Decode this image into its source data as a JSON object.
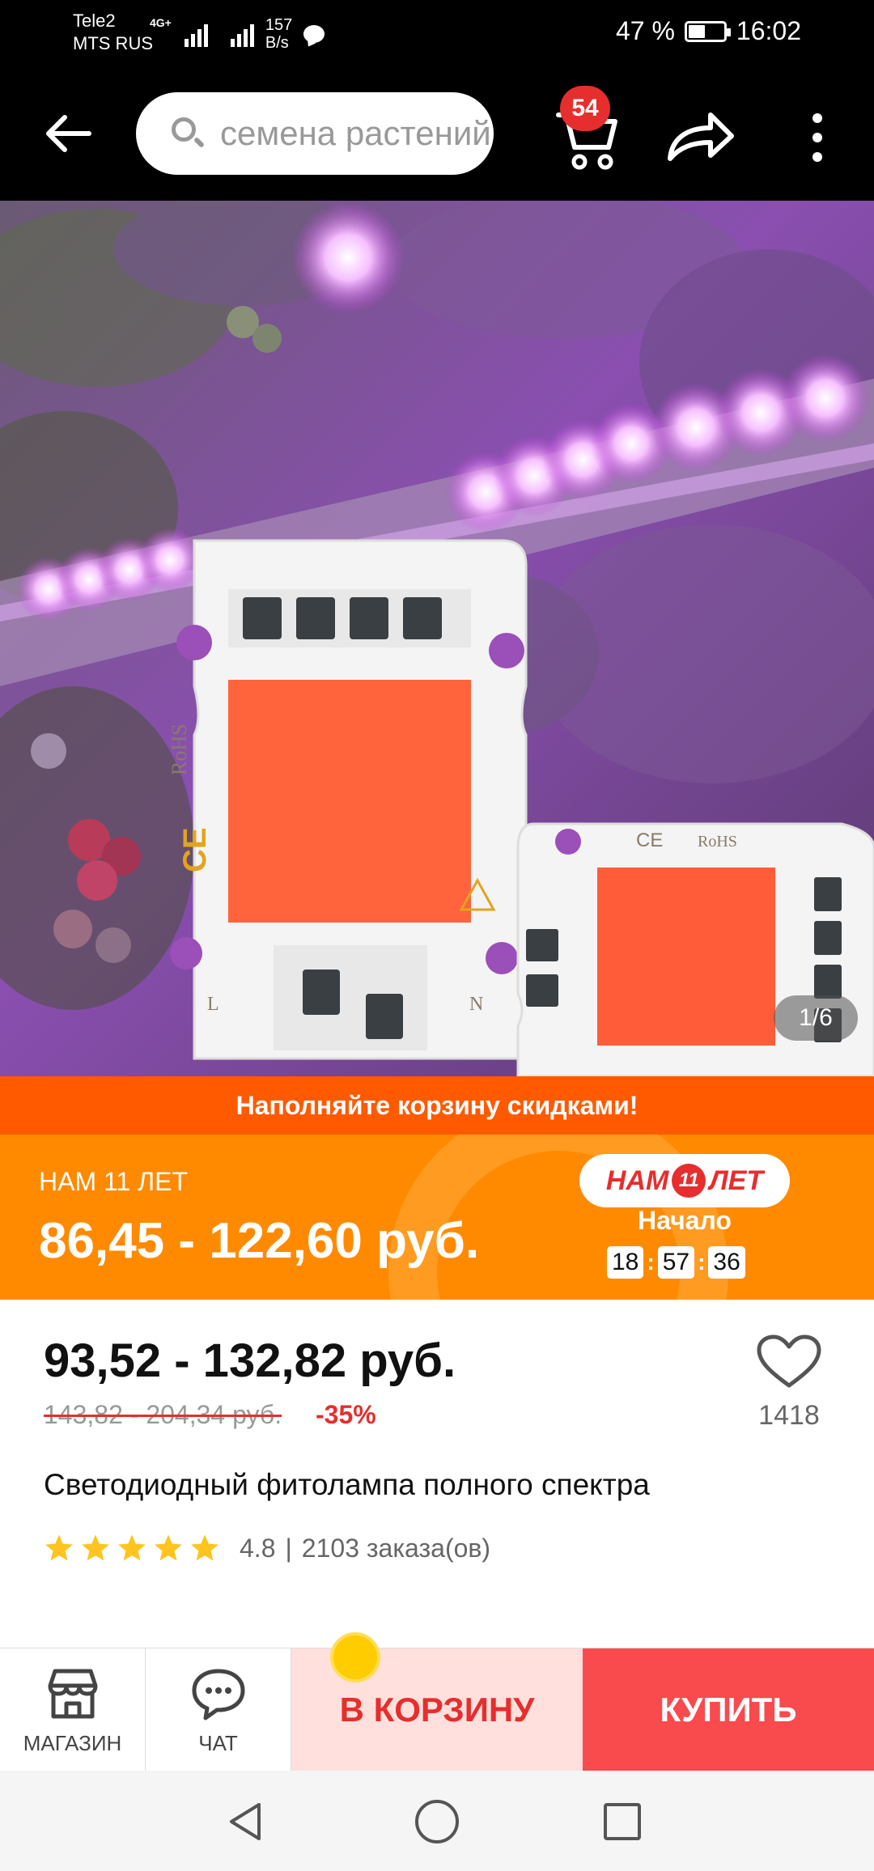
{
  "status_bar": {
    "carrier1": "Tele2",
    "carrier2": "MTS RUS",
    "network": "4G+",
    "speed_value": "157",
    "speed_unit": "B/s",
    "battery": "47 %",
    "time": "16:02"
  },
  "top_bar": {
    "search_placeholder": "семена растений",
    "cart_count": "54"
  },
  "gallery": {
    "counter": "1/6",
    "chip_small_labels": [
      "RoHS",
      "CE",
      "L",
      "N"
    ]
  },
  "promo": {
    "strip_text": "Наполняйте корзину скидками!",
    "label": "НАМ 11 ЛЕТ",
    "price": "86,45 - 122,60 руб.",
    "logo_text_left": "НАМ",
    "logo_number": "11",
    "logo_text_right": "ЛЕТ",
    "start_label": "Начало",
    "timer": [
      "18",
      "57",
      "36"
    ]
  },
  "product": {
    "price": "93,52 - 132,82 руб.",
    "old_price": "143,82 - 204,34 руб.",
    "discount": "-35%",
    "wishlist_count": "1418",
    "title": "Светодиодный фитолампа полного спектра",
    "rating": "4.8",
    "orders": "2103 заказа(ов)",
    "stars": 5
  },
  "action_bar": {
    "store_label": "МАГАЗИН",
    "chat_label": "ЧАТ",
    "add_to_cart_label": "В КОРЗИНУ",
    "buy_label": "КУПИТЬ"
  },
  "colors": {
    "accent_red": "#e62e2e",
    "promo_orange": "#ff8a00",
    "promo_strip": "#ff5a00",
    "buy_red": "#f94a4e"
  }
}
